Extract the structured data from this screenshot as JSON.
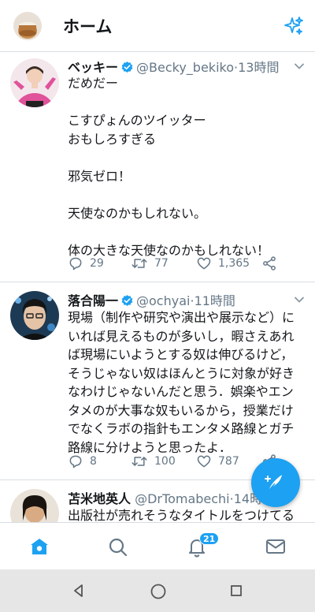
{
  "header": {
    "title": "ホーム",
    "sparkle_icon": "sparkle-icon"
  },
  "tweets": [
    {
      "name": "ベッキー",
      "verified": true,
      "handle": "@Becky_bekiko",
      "separator": "·",
      "time": "13時間",
      "text": "だめだー\n\nこすぴょんのツイッター\nおもしろすぎる\n\n邪気ゼロ！\n\n天使なのかもしれない。\n\n体の大きな天使なのかもしれない！",
      "replies": "29",
      "retweets": "77",
      "likes": "1,365"
    },
    {
      "name": "落合陽一",
      "verified": true,
      "handle": "@ochyai",
      "separator": "·",
      "time": "11時間",
      "text": "現場（制作や研究や演出や展示など）にいれば見えるものが多いし，暇さえあれば現場にいようとする奴は伸びるけど，そうじゃない奴はほんとうに対象が好きなわけじゃないんだと思う．娯楽やエンタメのが大事な奴もいるから，授業だけでなくラボの指針もエンタメ路線とガチ路線に分けようと思ったよ．",
      "replies": "8",
      "retweets": "100",
      "likes": "787"
    },
    {
      "name": "苫米地英人",
      "verified": false,
      "handle": "@DrTomabechi",
      "separator": "·",
      "time": "14時",
      "text": "出版社が売れそうなタイトルをつけてる"
    }
  ],
  "bottom_nav": {
    "items": [
      "home-icon",
      "search-icon",
      "notifications-icon",
      "messages-icon"
    ],
    "notification_badge": "21"
  },
  "colors": {
    "accent": "#1da1f2",
    "text": "#14171a",
    "muted": "#657786",
    "divider": "#d8dde2"
  }
}
